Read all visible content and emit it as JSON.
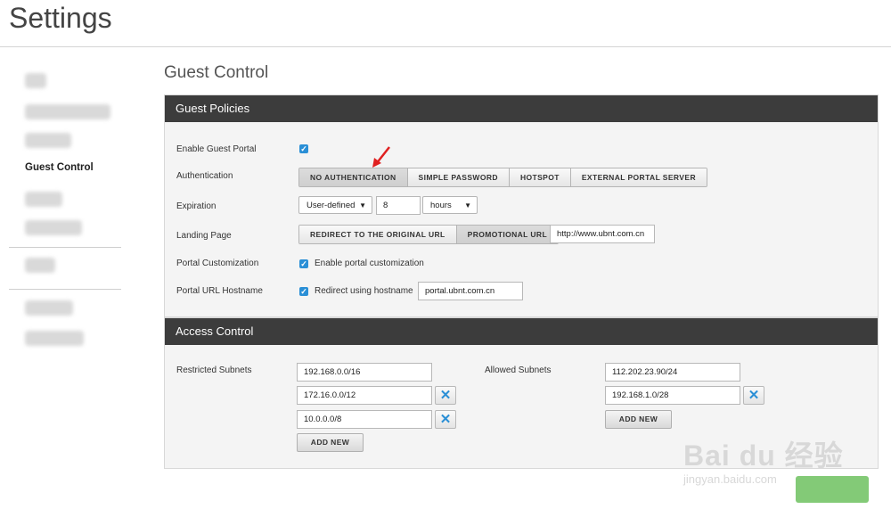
{
  "header": {
    "title": "Settings"
  },
  "sidebar": {
    "active_item": "Guest Control"
  },
  "main": {
    "title": "Guest Control"
  },
  "guest_policies": {
    "heading": "Guest Policies",
    "enable_guest_portal": {
      "label": "Enable Guest Portal",
      "checked": true
    },
    "authentication": {
      "label": "Authentication",
      "options": [
        "NO AUTHENTICATION",
        "SIMPLE PASSWORD",
        "HOTSPOT",
        "EXTERNAL PORTAL SERVER"
      ],
      "selected": "NO AUTHENTICATION"
    },
    "expiration": {
      "label": "Expiration",
      "mode": "User-defined",
      "value": "8",
      "unit": "hours"
    },
    "landing_page": {
      "label": "Landing Page",
      "options": [
        "REDIRECT TO THE ORIGINAL URL",
        "PROMOTIONAL URL"
      ],
      "selected": "PROMOTIONAL URL",
      "url": "http://www.ubnt.com.cn"
    },
    "portal_customization": {
      "label": "Portal Customization",
      "checkbox_label": "Enable portal customization",
      "checked": true
    },
    "portal_url_hostname": {
      "label": "Portal URL Hostname",
      "checkbox_label": "Redirect using hostname",
      "checked": true,
      "hostname": "portal.ubnt.com.cn"
    }
  },
  "access_control": {
    "heading": "Access Control",
    "restricted": {
      "label": "Restricted Subnets",
      "subnets": [
        "192.168.0.0/16",
        "172.16.0.0/12",
        "10.0.0.0/8"
      ],
      "add_label": "ADD NEW"
    },
    "allowed": {
      "label": "Allowed Subnets",
      "subnets": [
        "112.202.23.90/24",
        "192.168.1.0/28"
      ],
      "add_label": "ADD NEW"
    }
  },
  "icons": {
    "remove": "close-icon",
    "check": "checkmark-icon",
    "caret": "chevron-down-icon"
  },
  "colors": {
    "accent": "#2a8fd6",
    "header": "#3c3c3c",
    "apply": "#5ab84a"
  },
  "watermark": {
    "logo": "Bai du 经验",
    "url": "jingyan.baidu.com"
  }
}
